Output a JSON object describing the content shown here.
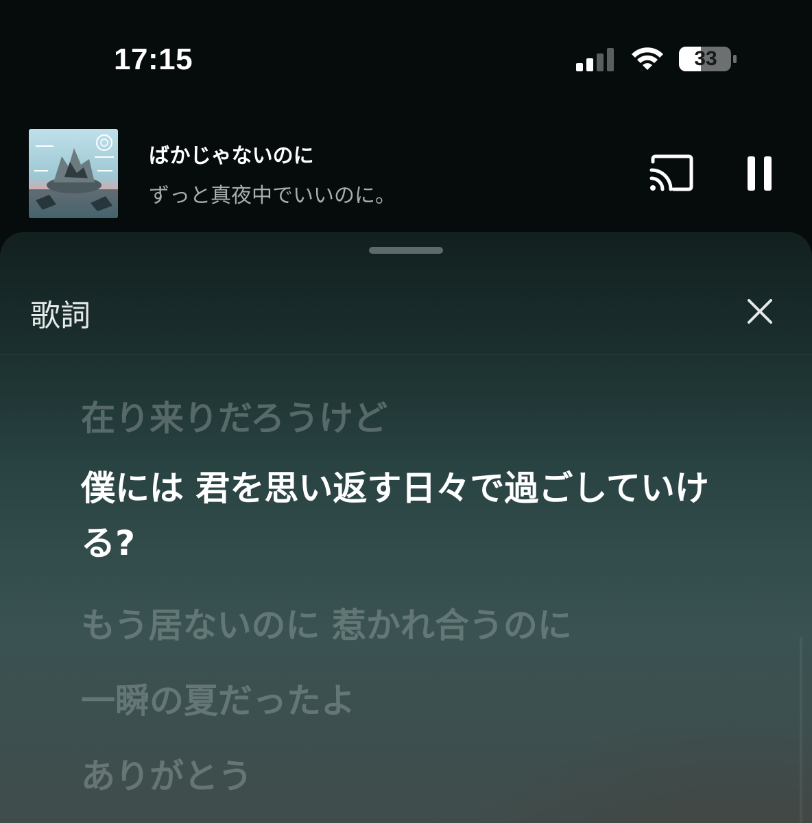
{
  "status_bar": {
    "time": "17:15",
    "battery_level": "33",
    "signal_bars_active": 2,
    "signal_bars_total": 4,
    "icons": [
      "signal-icon",
      "wifi-icon",
      "battery-icon"
    ]
  },
  "now_playing": {
    "title": "ばかじゃないのに",
    "artist": "ずっと真夜中でいいのに。",
    "icons": [
      "cast-icon",
      "pause-icon"
    ]
  },
  "lyrics_sheet": {
    "title": "歌詞",
    "close_icon": "close-icon",
    "lines": [
      "在り来りだろうけど",
      "僕には 君を思い返す日々で過ごしていける?",
      "もう居ないのに 惹かれ合うのに",
      "一瞬の夏だったよ",
      "ありがとう"
    ],
    "active_line_index": 1
  },
  "colors": {
    "background": "#060b0c",
    "text_primary": "#ffffff",
    "text_secondary": "#a9adae",
    "lyric_inactive": "#a0acac",
    "sheet_top": "#12201f",
    "sheet_bottom": "#404c4b"
  }
}
